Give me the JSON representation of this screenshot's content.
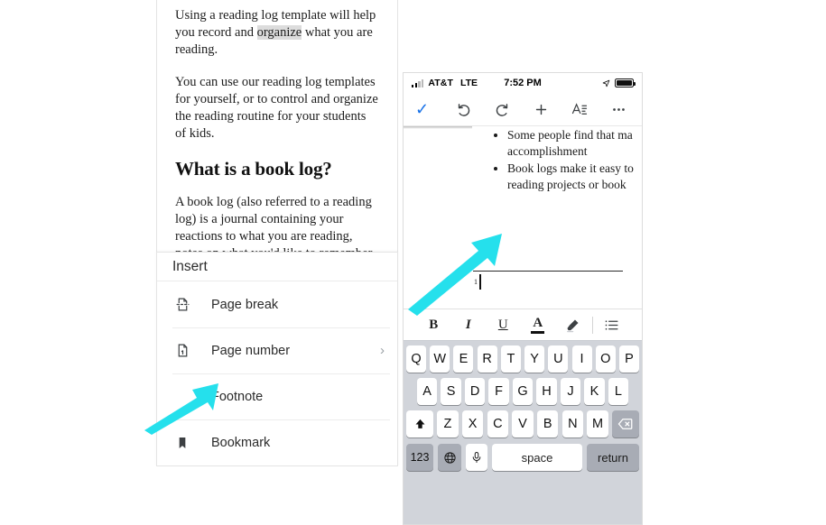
{
  "article": {
    "paragraphs": [
      {
        "pre": "Using a reading log template will help you record and ",
        "highlight": "organize",
        "post": " what you are reading."
      },
      {
        "pre": "You can use our reading log templates for yourself, or to control and organize the reading routine for your students of kids.",
        "highlight": "",
        "post": ""
      }
    ],
    "heading": "What is a book log?",
    "last_paragraph": "A book log (also referred to a reading log) is a journal containing your reactions to what you are reading, notes on what you'd like to remember"
  },
  "insert_menu": {
    "title": "Insert",
    "items": [
      {
        "label": "Page break",
        "icon": "page-break-icon",
        "chevron": ""
      },
      {
        "label": "Page number",
        "icon": "page-number-icon",
        "chevron": "›"
      },
      {
        "label": "Footnote",
        "icon": "",
        "chevron": ""
      },
      {
        "label": "Bookmark",
        "icon": "bookmark-icon",
        "chevron": ""
      }
    ]
  },
  "phone": {
    "status_bar": {
      "carrier": "AT&T",
      "network": "LTE",
      "time": "7:52 PM",
      "location_icon": "location-arrow-icon",
      "battery_icon": "battery-full-icon"
    },
    "doc_toolbar": {
      "done": "✓",
      "undo": "undo-icon",
      "redo": "redo-icon",
      "insert": "+",
      "format": "format-icon",
      "more": "⋯"
    },
    "document": {
      "bullets": [
        "Some people find that ma accomplishment",
        "Book logs make it easy to reading projects or book"
      ],
      "footnote_marker": "1"
    },
    "format_bar": {
      "bold": "B",
      "italic": "I",
      "underline": "U",
      "text_color": "A",
      "highlight": "highlighter-icon",
      "list": "bullet-list-icon"
    },
    "keyboard": {
      "row1": [
        "Q",
        "W",
        "E",
        "R",
        "T",
        "Y",
        "U",
        "I",
        "O",
        "P"
      ],
      "row2": [
        "A",
        "S",
        "D",
        "F",
        "G",
        "H",
        "J",
        "K",
        "L"
      ],
      "row3_letters": [
        "Z",
        "X",
        "C",
        "V",
        "B",
        "N",
        "M"
      ],
      "shift": "shift-icon",
      "backspace": "backspace-icon",
      "numbers": "123",
      "globe": "globe-icon",
      "mic": "microphone-icon",
      "space": "space",
      "return": "return"
    }
  },
  "annotations": {
    "arrow_color": "#25E0EC",
    "arrows": [
      {
        "name": "arrow-to-footnote-cursor"
      },
      {
        "name": "arrow-to-footnote-menu-item"
      }
    ]
  }
}
